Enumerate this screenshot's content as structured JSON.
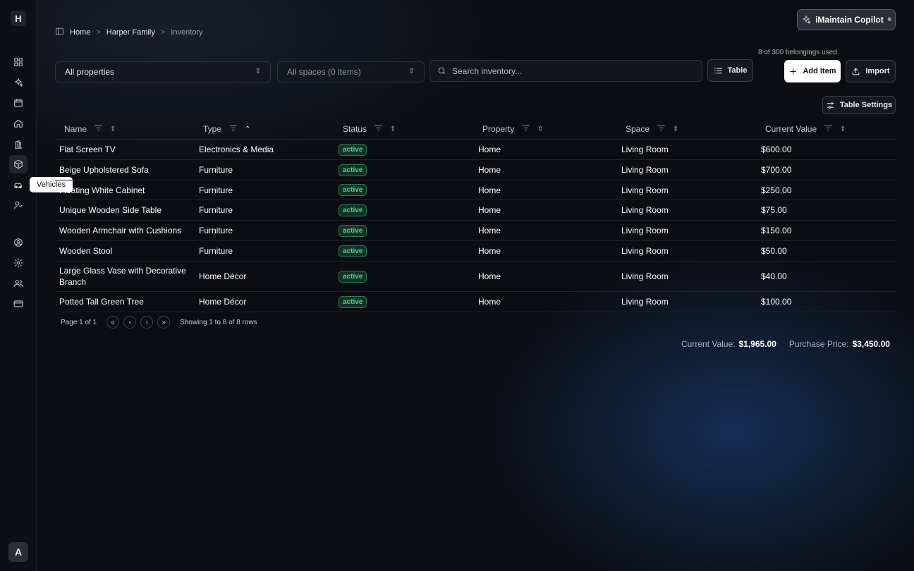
{
  "app": {
    "logo_letter": "H",
    "avatar_letter": "A",
    "copilot_label": "iMaintain Copilot",
    "copilot_mark": "®"
  },
  "sidebar": {
    "tooltip": "Vehicles",
    "icons": [
      "dashboard-icon",
      "sparkle-icon",
      "calendar-icon",
      "home-icon",
      "building-icon",
      "box-icon",
      "car-icon",
      "tools-icon",
      "user-circle-icon",
      "gear-icon",
      "users-icon",
      "credit-card-icon"
    ]
  },
  "breadcrumb": {
    "items": [
      "Home",
      "Harper Family",
      "Inventory"
    ],
    "separator": ">"
  },
  "usage": "8 of 300 belongings used",
  "toolbar": {
    "property_select": "All properties",
    "space_select": "All spaces (0 items)",
    "search_placeholder": "Search inventory...",
    "view_button": "Table",
    "add_button": "Add Item",
    "import_button": "Import",
    "table_settings": "Table Settings"
  },
  "table": {
    "columns": [
      "Name",
      "Type",
      "Status",
      "Property",
      "Space",
      "Current Value"
    ],
    "rows": [
      {
        "name": "Flat Screen TV",
        "type": "Electronics & Media",
        "status": "active",
        "property": "Home",
        "space": "Living Room",
        "value": "$600.00"
      },
      {
        "name": "Beige Upholstered Sofa",
        "type": "Furniture",
        "status": "active",
        "property": "Home",
        "space": "Living Room",
        "value": "$700.00"
      },
      {
        "name": "Floating White Cabinet",
        "type": "Furniture",
        "status": "active",
        "property": "Home",
        "space": "Living Room",
        "value": "$250.00"
      },
      {
        "name": "Unique Wooden Side Table",
        "type": "Furniture",
        "status": "active",
        "property": "Home",
        "space": "Living Room",
        "value": "$75.00"
      },
      {
        "name": "Wooden Armchair with Cushions",
        "type": "Furniture",
        "status": "active",
        "property": "Home",
        "space": "Living Room",
        "value": "$150.00"
      },
      {
        "name": "Wooden Stool",
        "type": "Furniture",
        "status": "active",
        "property": "Home",
        "space": "Living Room",
        "value": "$50.00"
      },
      {
        "name": "Large Glass Vase with Decorative Branch",
        "type": "Home Décor",
        "status": "active",
        "property": "Home",
        "space": "Living Room",
        "value": "$40.00"
      },
      {
        "name": "Potted Tall Green Tree",
        "type": "Home Décor",
        "status": "active",
        "property": "Home",
        "space": "Living Room",
        "value": "$100.00"
      }
    ]
  },
  "pagination": {
    "page_label": "Page 1 of 1",
    "showing": "Showing 1 to 8 of 8 rows"
  },
  "totals": {
    "current_label": "Current Value:",
    "current_value": "$1,965.00",
    "purchase_label": "Purchase Price:",
    "purchase_value": "$3,450.00"
  }
}
